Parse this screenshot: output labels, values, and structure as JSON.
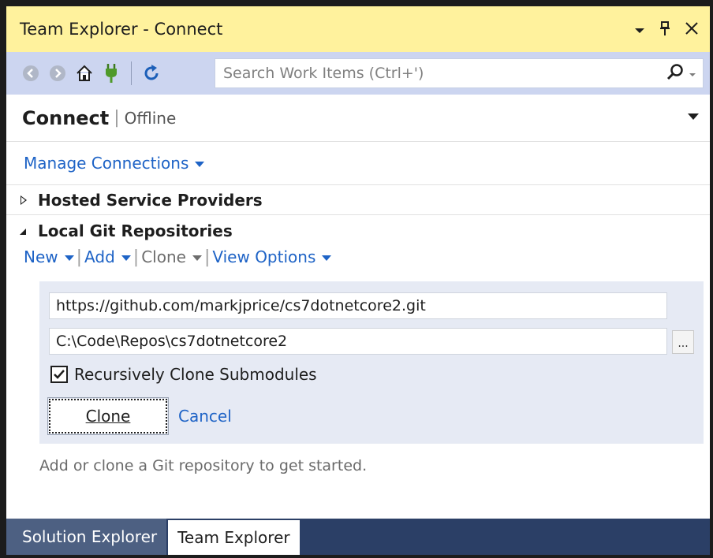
{
  "window": {
    "title": "Team Explorer - Connect",
    "icons": [
      "dropdown-arrow-icon",
      "pin-icon",
      "close-icon"
    ]
  },
  "toolbar": {
    "buttons": [
      "back-icon",
      "forward-icon",
      "home-icon",
      "connect-plug-icon",
      "refresh-icon"
    ],
    "search_placeholder": "Search Work Items (Ctrl+')"
  },
  "header": {
    "title": "Connect",
    "separator": "|",
    "status": "Offline"
  },
  "manage_connections": "Manage Connections",
  "sections": {
    "hosted": "Hosted Service Providers",
    "local": "Local Git Repositories"
  },
  "actions": {
    "new": "New",
    "add": "Add",
    "clone": "Clone",
    "view_options": "View Options",
    "separator": "|"
  },
  "clone_panel": {
    "url_value": "https://github.com/markjprice/cs7dotnetcore2.git",
    "path_value": "C:\\Code\\Repos\\cs7dotnetcore2",
    "browse_label": "...",
    "recursive_label": "Recursively Clone Submodules",
    "recursive_checked": true,
    "clone_button": "Clone",
    "cancel_link": "Cancel"
  },
  "hint": "Add or clone a Git repository to get started.",
  "bottom_tabs": [
    "Solution Explorer",
    "Team Explorer"
  ],
  "colors": {
    "title_bar": "#fff29d",
    "toolbar": "#ccd5f0",
    "link": "#1e63c6",
    "clone_panel": "#e6eaf4",
    "tab_strip": "#2b3f66"
  }
}
